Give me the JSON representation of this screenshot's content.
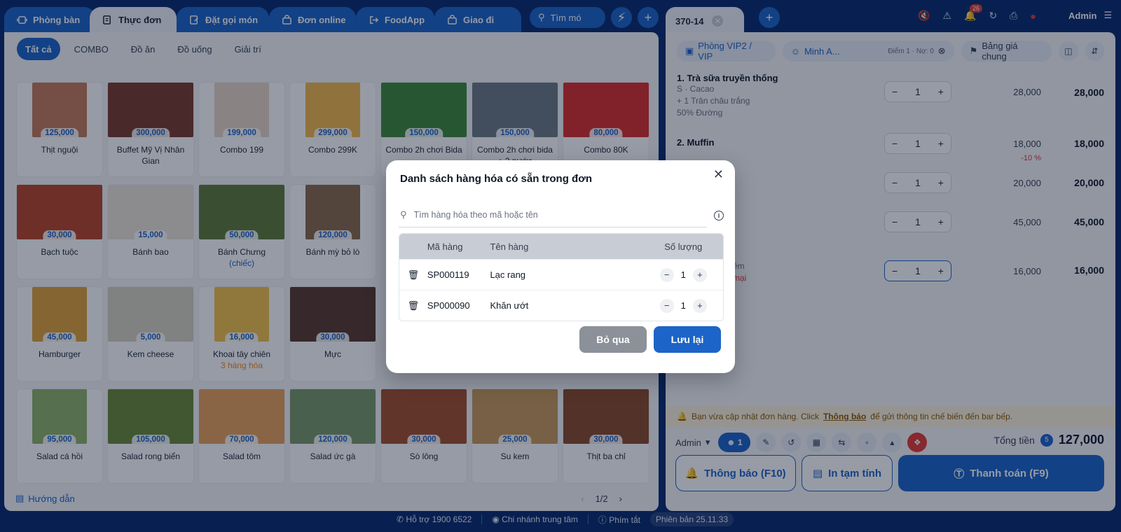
{
  "tabs": [
    {
      "label": "Phòng bàn",
      "icon": "table-icon"
    },
    {
      "label": "Thực đơn",
      "icon": "menu-icon"
    },
    {
      "label": "Đặt gọi món",
      "icon": "order-edit-icon"
    },
    {
      "label": "Đơn online",
      "icon": "bag-icon"
    },
    {
      "label": "FoodApp",
      "icon": "login-icon"
    },
    {
      "label": "Giao đi",
      "icon": "bag-icon"
    }
  ],
  "search_label": "Tìm mó",
  "filters": [
    "Tất cả",
    "COMBO",
    "Đồ ăn",
    "Đồ uống",
    "Giải trí"
  ],
  "products": [
    {
      "name": "Thịt nguội",
      "price": "125,000",
      "sub": "",
      "color": "#c47a5a",
      "wide": false
    },
    {
      "name": "Buffet Mỹ Vị Nhân Gian",
      "price": "300,000",
      "sub": "",
      "color": "#7a3b2e",
      "wide": true
    },
    {
      "name": "Combo 199",
      "price": "199,000",
      "sub": "",
      "color": "#e9d6c6",
      "wide": false
    },
    {
      "name": "Combo 299K",
      "price": "299,000",
      "sub": "",
      "color": "#f2b84b",
      "wide": false
    },
    {
      "name": "Combo 2h chơi Bida",
      "price": "150,000",
      "sub": "",
      "color": "#3f8a3a",
      "wide": true
    },
    {
      "name": "Combo 2h chơi bida + 2 nước",
      "price": "150,000",
      "sub": "",
      "color": "#6d7b86",
      "wide": true
    },
    {
      "name": "Combo 80K",
      "price": "80,000",
      "sub": "",
      "color": "#d9302c",
      "wide": true
    },
    {
      "name": "Bạch tuộc",
      "price": "30,000",
      "sub": "",
      "color": "#b9452a",
      "wide": true
    },
    {
      "name": "Bánh bao",
      "price": "15,000",
      "sub": "",
      "color": "#ece4d6",
      "wide": true
    },
    {
      "name": "Bánh Chưng",
      "price": "50,000",
      "sub": "(chiếc)",
      "sub_color": "blue",
      "color": "#5f7d3a",
      "wide": true
    },
    {
      "name": "Bánh mỳ bỏ lò",
      "price": "120,000",
      "sub": "",
      "color": "#8a6a4a",
      "wide": false
    },
    {
      "name": "",
      "price": "",
      "sub": "",
      "color": "#9a7a5a",
      "wide": false
    },
    {
      "name": "",
      "price": "",
      "sub": "",
      "color": "#f5f6f8",
      "wide": false
    },
    {
      "name": "",
      "price": "",
      "sub": "",
      "color": "#f5f6f8",
      "wide": false
    },
    {
      "name": "Hamburger",
      "price": "45,000",
      "sub": "",
      "color": "#e0a23a",
      "wide": false
    },
    {
      "name": "Kem cheese",
      "price": "5,000",
      "sub": "",
      "color": "#d8d2c2",
      "wide": true
    },
    {
      "name": "Khoai tây chiên",
      "price": "16,000",
      "sub": "3 hàng hóa",
      "sub_color": "orange",
      "color": "#f3c34a",
      "wide": false
    },
    {
      "name": "Mực",
      "price": "30,000",
      "sub": "",
      "color": "#5a3a2e",
      "wide": true
    },
    {
      "name": "",
      "price": "",
      "sub": "",
      "color": "#f5f6f8",
      "wide": false
    },
    {
      "name": "",
      "price": "",
      "sub": "",
      "color": "#f5f6f8",
      "wide": false
    },
    {
      "name": "",
      "price": "",
      "sub": "",
      "color": "#f5f6f8",
      "wide": false
    },
    {
      "name": "Salad cá hồi",
      "price": "95,000",
      "sub": "",
      "color": "#8fb36a",
      "wide": false
    },
    {
      "name": "Salad rong biển",
      "price": "105,000",
      "sub": "",
      "color": "#6a8a3a",
      "wide": true
    },
    {
      "name": "Salad tôm",
      "price": "70,000",
      "sub": "",
      "color": "#e9a25a",
      "wide": true
    },
    {
      "name": "Salad ức gà",
      "price": "120,000",
      "sub": "",
      "color": "#7a9a6a",
      "wide": true
    },
    {
      "name": "Sò lông",
      "price": "30,000",
      "sub": "",
      "color": "#a4502e",
      "wide": true
    },
    {
      "name": "Su kem",
      "price": "25,000",
      "sub": "",
      "color": "#c99a5a",
      "wide": true
    },
    {
      "name": "Thịt ba chỉ",
      "price": "30,000",
      "sub": "",
      "color": "#8a4a2a",
      "wide": true
    }
  ],
  "guide_label": "Hướng dẫn",
  "page": "1/2",
  "order": {
    "tab_label": "370-14",
    "room": "Phòng VIP2 / VIP",
    "customer": "Minh A...",
    "points": "Điểm 1 · Nợ: 0",
    "price_list": "Bảng giá chung",
    "notifications": "26",
    "user": "Admin",
    "items": [
      {
        "name": "1. Trà sữa truyền thống",
        "details": [
          "S · Cacao",
          "+ 1 Trân châu trắng",
          "50% Đường"
        ],
        "qty": "1",
        "unit": "28,000",
        "total": "28,000",
        "discount": ""
      },
      {
        "name": "2. Muffin",
        "details": [],
        "qty": "1",
        "unit": "18,000",
        "total": "18,000",
        "discount": "-10 %"
      },
      {
        "name": "",
        "details": [],
        "qty": "1",
        "unit": "20,000",
        "total": "20,000",
        "discount": ""
      },
      {
        "name": "",
        "details": [],
        "qty": "1",
        "unit": "45,000",
        "total": "45,000",
        "discount": ""
      },
      {
        "name": "",
        "details": [
          "thêm",
          "n mại"
        ],
        "qty": "1",
        "unit": "16,000",
        "total": "16,000",
        "discount": ""
      }
    ],
    "notice_pre": "Bạn vừa cập nhật đơn hàng. Click ",
    "notice_link": "Thông báo",
    "notice_post": " để gửi thông tin chế biến đến bar bếp.",
    "staff": "Admin",
    "guest_count": "1",
    "total_label": "Tổng tiền",
    "item_count": "5",
    "total_amount": "127,000",
    "btn_notify": "Thông báo (F10)",
    "btn_print": "In tạm tính",
    "btn_pay": "Thanh toán (F9)"
  },
  "footer": {
    "support": "Hỗ trợ 1900 6522",
    "branch": "Chi nhánh trung tâm",
    "shortcut": "Phím tắt",
    "version": "Phiên bản 25.11.33"
  },
  "modal": {
    "title": "Danh sách hàng hóa có sẵn trong đơn",
    "search_placeholder": "Tìm hàng hóa theo mã hoặc tên",
    "col_code": "Mã hàng",
    "col_name": "Tên hàng",
    "col_qty": "Số lượng",
    "rows": [
      {
        "code": "SP000119",
        "name": "Lạc rang",
        "qty": "1"
      },
      {
        "code": "SP000090",
        "name": "Khăn ướt",
        "qty": "1"
      }
    ],
    "btn_skip": "Bỏ qua",
    "btn_save": "Lưu lại"
  }
}
